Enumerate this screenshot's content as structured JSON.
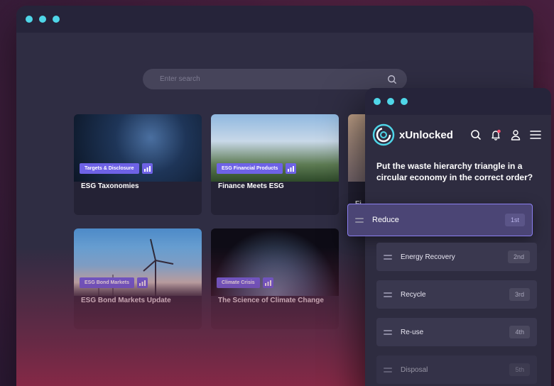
{
  "back_window": {
    "search": {
      "placeholder": "Enter search"
    },
    "cards": [
      {
        "tag": "Targets & Disclosure",
        "title": "ESG Taxonomies"
      },
      {
        "tag": "ESG Financial Products",
        "title": "Finance Meets ESG"
      },
      {
        "tag": "ESG Bond Markets",
        "title": "ESG Bond Markets Update"
      },
      {
        "tag": "Climate Crisis",
        "title": "The Science of Climate Change"
      },
      {
        "tag": "",
        "title": "Fi"
      }
    ]
  },
  "front_window": {
    "brand": "xUnlocked",
    "question": "Put the waste hierarchy triangle in a circular economy in the correct order?",
    "options": [
      {
        "label": "Reduce",
        "rank": "1st"
      },
      {
        "label": "Energy Recovery",
        "rank": "2nd"
      },
      {
        "label": "Recycle",
        "rank": "3rd"
      },
      {
        "label": "Re-use",
        "rank": "4th"
      },
      {
        "label": "Disposal",
        "rank": "5th"
      }
    ]
  },
  "colors": {
    "accent": "#6e62e6",
    "dot": "#4fd6e8",
    "notification": "#ff4d6d"
  }
}
